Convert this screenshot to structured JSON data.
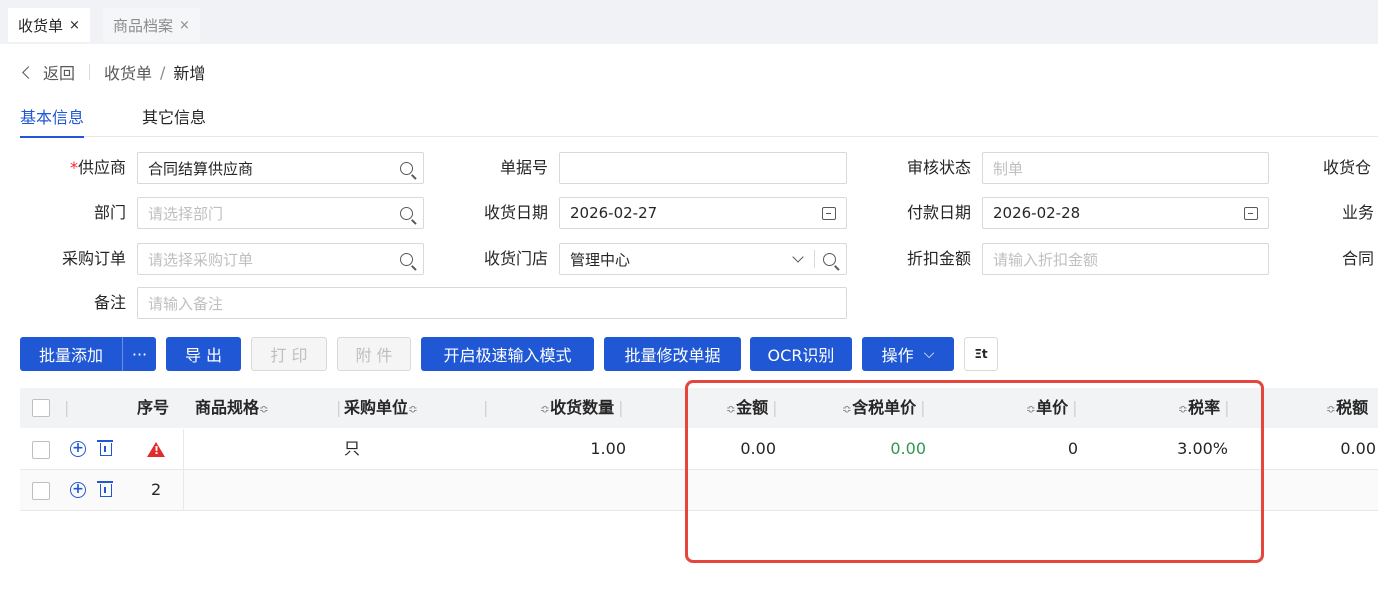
{
  "tabs": [
    {
      "label": "收货单",
      "close": "×"
    },
    {
      "label": "商品档案",
      "close": "×"
    }
  ],
  "breadcrumb": {
    "back_icon": "chevron-left-icon",
    "back": "返回",
    "parent": "收货单",
    "separator": "/",
    "current": "新增"
  },
  "section_tabs": [
    "基本信息",
    "其它信息"
  ],
  "form": {
    "supplier": {
      "required_mark": "*",
      "label": "供应商",
      "value": "合同结算供应商"
    },
    "department": {
      "label": "部门",
      "placeholder": "请选择部门"
    },
    "purchase_order": {
      "label": "采购订单",
      "placeholder": "请选择采购订单"
    },
    "remark": {
      "label": "备注",
      "placeholder": "请输入备注"
    },
    "doc_no": {
      "label": "单据号",
      "value": ""
    },
    "receive_date": {
      "label": "收货日期",
      "value": "2026-02-27"
    },
    "receive_store": {
      "label": "收货门店",
      "value": "管理中心"
    },
    "audit_status": {
      "label": "审核状态",
      "placeholder": "制单"
    },
    "pay_date": {
      "label": "付款日期",
      "value": "2026-02-28"
    },
    "discount": {
      "label": "折扣金额",
      "placeholder": "请输入折扣金额"
    },
    "cut_labels": [
      "收货仓",
      "业务",
      "合同"
    ]
  },
  "toolbar": {
    "batch_add": "批量添加",
    "more": "···",
    "export": "导 出",
    "print": "打 印",
    "attach": "附 件",
    "fast_mode": "开启极速输入模式",
    "batch_edit": "批量修改单据",
    "ocr": "OCR识别",
    "ops": "操作",
    "ops_caret": "⌵",
    "col_settings": "Ξt"
  },
  "grid": {
    "headers": {
      "seq": "序号",
      "spec": "商品规格",
      "unit": "采购单位",
      "qty": "收货数量",
      "amount": "金额",
      "tax_price": "含税单价",
      "price": "单价",
      "tax_rate": "税率",
      "tax": "税额"
    },
    "sort_glyph": "≎",
    "divider": "|",
    "rows": [
      {
        "seq": "",
        "warning": true,
        "unit": "只",
        "qty": "1.00",
        "amount": "0.00",
        "tax_price": "0.00",
        "price": "0",
        "tax_rate": "3.00%",
        "tax": "0.00"
      },
      {
        "seq": "2",
        "warning": false,
        "unit": "",
        "qty": "",
        "amount": "",
        "tax_price": "",
        "price": "",
        "tax_rate": "",
        "tax": ""
      }
    ]
  },
  "colors": {
    "primary": "#1f57d4",
    "highlight_box": "#e5453b",
    "green_value": "#2e9a4f",
    "warning": "#e12b2b"
  }
}
